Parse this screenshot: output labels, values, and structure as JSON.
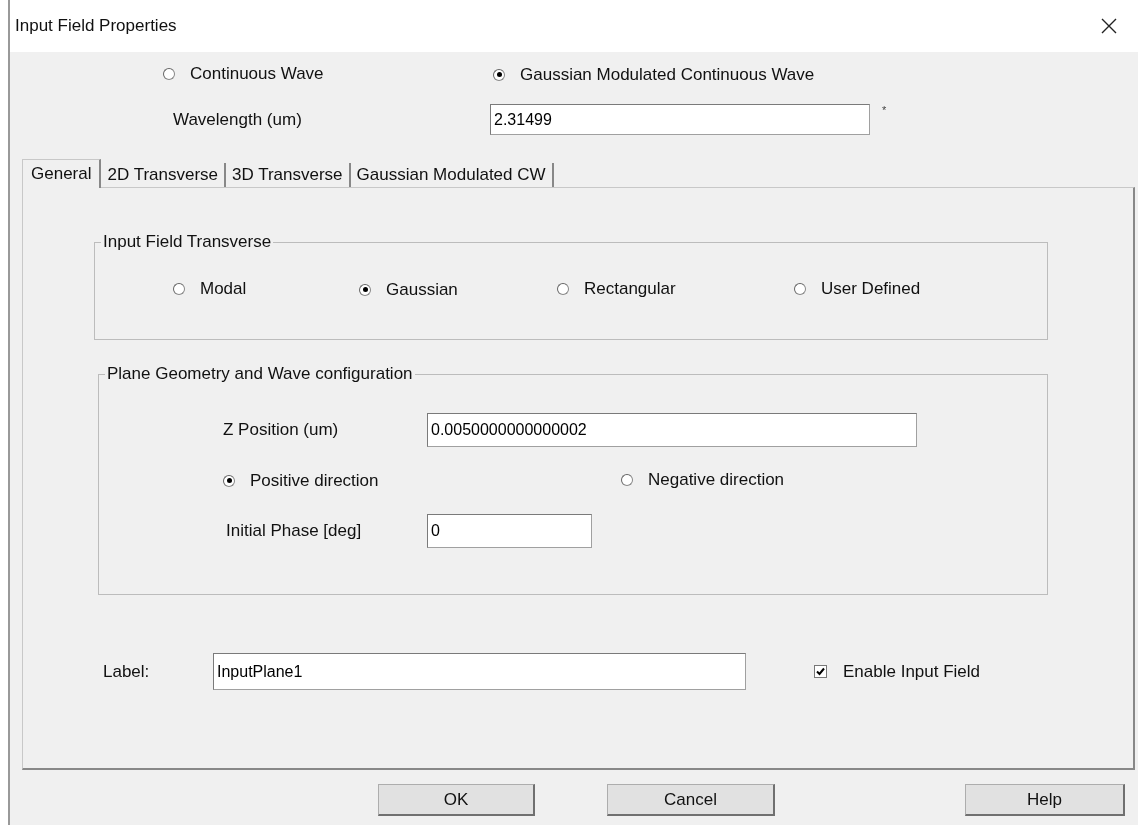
{
  "window": {
    "title": "Input Field Properties"
  },
  "wave_type": [
    {
      "label": "Continuous Wave",
      "selected": false
    },
    {
      "label": "Gaussian Modulated Continuous Wave",
      "selected": true
    }
  ],
  "wavelength": {
    "label": "Wavelength (um)",
    "value": "2.31499",
    "note_mark": "*"
  },
  "tabs": [
    {
      "label": "General",
      "selected": true
    },
    {
      "label": "2D Transverse",
      "selected": false
    },
    {
      "label": "3D Transverse",
      "selected": false
    },
    {
      "label": "Gaussian Modulated CW",
      "selected": false
    }
  ],
  "transverse_group": {
    "title": "Input Field Transverse",
    "options": [
      {
        "label": "Modal",
        "selected": false
      },
      {
        "label": "Gaussian",
        "selected": true
      },
      {
        "label": "Rectangular",
        "selected": false
      },
      {
        "label": "User Defined",
        "selected": false
      }
    ]
  },
  "plane_group": {
    "title": "Plane Geometry and Wave configuration",
    "z_position": {
      "label": "Z Position (um)",
      "value": "0.0050000000000002"
    },
    "direction": [
      {
        "label": "Positive direction",
        "selected": true
      },
      {
        "label": "Negative direction",
        "selected": false
      }
    ],
    "initial_phase": {
      "label": "Initial Phase [deg]",
      "value": "0"
    }
  },
  "label_field": {
    "label": "Label:",
    "value": "InputPlane1"
  },
  "enable_input_field": {
    "label": "Enable Input Field",
    "checked": true
  },
  "buttons": [
    "OK",
    "Cancel",
    "Help"
  ]
}
